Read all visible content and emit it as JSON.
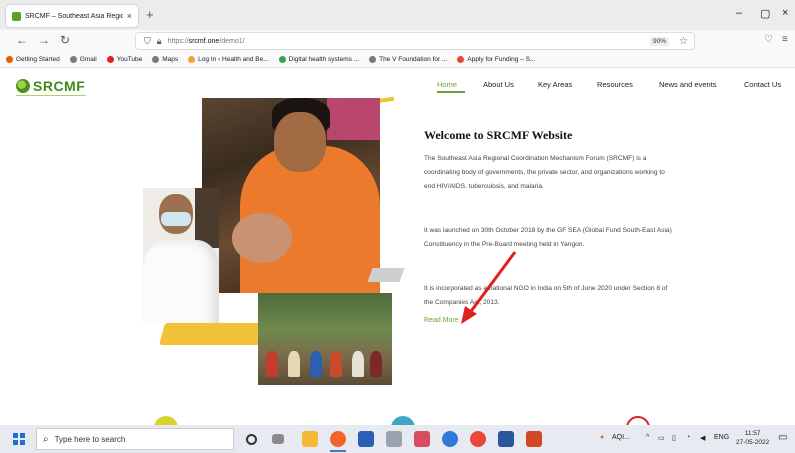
{
  "browser": {
    "tab_title": "SRCMF – Southeast Asia Regio",
    "tab_close": "×",
    "new_tab": "+",
    "win_min": "–",
    "win_max": "▢",
    "win_close": "×",
    "back": "←",
    "forward": "→",
    "reload": "↻",
    "url_prefix": "https://",
    "url_domain": "srcmf.one",
    "url_path": "/demo1/",
    "zoom": "90%",
    "bookmarks": [
      {
        "label": "Getting Started",
        "color": "#e66000"
      },
      {
        "label": "Gmail",
        "color": "#7a7a7a"
      },
      {
        "label": "YouTube",
        "color": "#e62117"
      },
      {
        "label": "Maps",
        "color": "#7a7a7a"
      },
      {
        "label": "Log In ‹ Health and Be...",
        "color": "#f2a32a"
      },
      {
        "label": "Digital health systems ...",
        "color": "#37a24b"
      },
      {
        "label": "The V Foundation for ...",
        "color": "#7a7a7a"
      },
      {
        "label": "Apply for Funding – S...",
        "color": "#e24a3b"
      }
    ]
  },
  "site": {
    "logo": "SRCMF",
    "menu": [
      {
        "label": "Home",
        "active": true
      },
      {
        "label": "About Us"
      },
      {
        "label": "Key Areas"
      },
      {
        "label": "Resources"
      },
      {
        "label": "News and events"
      },
      {
        "label": "Contact Us"
      }
    ],
    "heading": "Welcome to SRCMF Website",
    "para1": "The Southeast Asia Regional Coordination Mechanism Forum (SRCMF) is a coordinating body of governments, the private sector, and organizations working to end HIV/AIDS, tuberculosis, and malaria.",
    "para2": "It was launched on 30th October 2018 by the GF SEA (Global Fund South-East Asia) Constituency in the Pre-Board meeting held in Yangon.",
    "para3": "It is incorporated as a national NGO in India on 5th of June 2020 under Section 8 of the Companies Act, 2013.",
    "read_more": "Read More",
    "accent": "#6aa534"
  },
  "taskbar": {
    "search_placeholder": "Type here to search",
    "weather": "AQI...",
    "lang": "ENG",
    "time": "11:57",
    "date": "27-05-2022"
  }
}
